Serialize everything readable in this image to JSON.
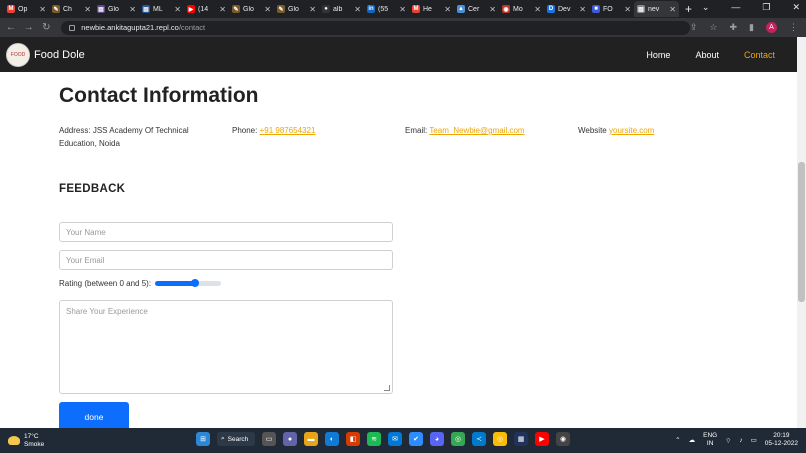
{
  "browser": {
    "tabs": [
      {
        "label": "Op",
        "color": "#ea4335",
        "glyph": "M"
      },
      {
        "label": "Ch",
        "color": "#7c5b2a",
        "glyph": "✎"
      },
      {
        "label": "Glo",
        "color": "#5f4b8b",
        "glyph": "▤"
      },
      {
        "label": "ML",
        "color": "#2b5797",
        "glyph": "▤"
      },
      {
        "label": "(14",
        "color": "#ff0000",
        "glyph": "▶"
      },
      {
        "label": "Glo",
        "color": "#7c5b2a",
        "glyph": "✎"
      },
      {
        "label": "Glo",
        "color": "#7c5b2a",
        "glyph": "✎"
      },
      {
        "label": "alb",
        "color": "#333333",
        "glyph": "●"
      },
      {
        "label": "(55",
        "color": "#0a66c2",
        "glyph": "in"
      },
      {
        "label": "He",
        "color": "#ea4335",
        "glyph": "M"
      },
      {
        "label": "Cer",
        "color": "#4a90d9",
        "glyph": "▲"
      },
      {
        "label": "Mo",
        "color": "#c0392b",
        "glyph": "◉"
      },
      {
        "label": "Dev",
        "color": "#1a73e8",
        "glyph": "D"
      },
      {
        "label": "FO",
        "color": "#3b5bdb",
        "glyph": "■"
      },
      {
        "label": "nev",
        "color": "#888888",
        "glyph": "▤"
      }
    ],
    "url_host": "newbie.ankitagupta21.repl.co",
    "url_path": "/contact",
    "profile_initial": "A"
  },
  "site": {
    "brand": "Food Dole",
    "logo_text": "FOOD",
    "nav": {
      "home": "Home",
      "about": "About",
      "contact": "Contact"
    }
  },
  "contact": {
    "heading": "Contact Information",
    "address_label": "Address:",
    "address_value": "JSS Academy Of Technical Education, Noida",
    "phone_label": "Phone:",
    "phone_value": "+91 987654321",
    "email_label": "Email:",
    "email_value": "Team_Newbie@gmail.com",
    "website_label": "Website",
    "website_value": "yoursite.com"
  },
  "feedback": {
    "heading": "FEEDBACK",
    "name_placeholder": "Your Name",
    "email_placeholder": "Your Email",
    "rating_label": "Rating (between 0 and 5):",
    "rating_value": 3,
    "rating_max": 5,
    "experience_placeholder": "Share Your Experience",
    "submit_label": "done"
  },
  "taskbar": {
    "temperature": "17°C",
    "weather": "Smoke",
    "search_label": "Search",
    "lang_top": "ENG",
    "lang_bottom": "IN",
    "time": "20:19",
    "date": "05-12-2022"
  }
}
